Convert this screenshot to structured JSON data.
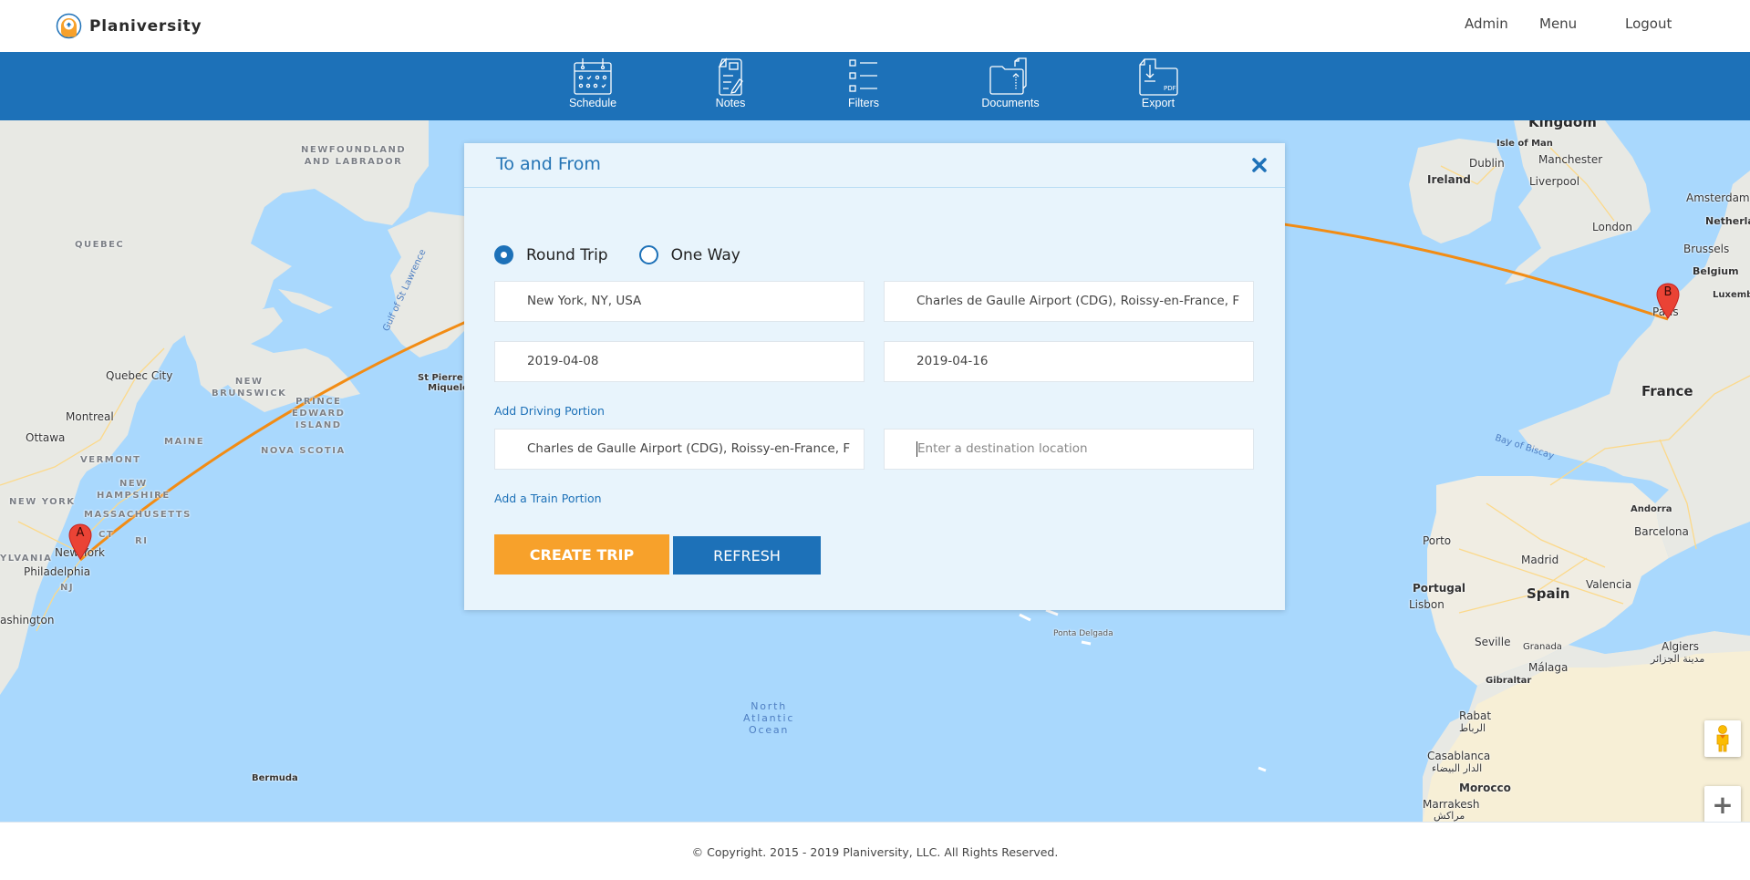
{
  "header": {
    "brand": "Planiversity",
    "nav": [
      {
        "label": "Admin"
      },
      {
        "label": "Menu"
      },
      {
        "label": "Logout"
      }
    ]
  },
  "toolbar": {
    "items": [
      {
        "label": "Schedule",
        "icon": "calendar-icon"
      },
      {
        "label": "Notes",
        "icon": "notes-icon"
      },
      {
        "label": "Filters",
        "icon": "filters-list-icon"
      },
      {
        "label": "Documents",
        "icon": "folder-upload-icon"
      },
      {
        "label": "Export",
        "icon": "pdf-export-icon"
      }
    ]
  },
  "dialog": {
    "title": "To and From",
    "close_icon": "close-icon",
    "trip_type": {
      "options": [
        {
          "label": "Round Trip",
          "checked": true
        },
        {
          "label": "One Way",
          "checked": false
        }
      ]
    },
    "origin": "New York, NY, USA",
    "destination": "Charles de Gaulle Airport (CDG), Roissy-en-France, F",
    "depart_date": "2019-04-08",
    "return_date": "2019-04-16",
    "add_driving_label": "Add Driving Portion",
    "driving_from": "Charles de Gaulle Airport (CDG), Roissy-en-France, F",
    "driving_to_value": "",
    "driving_to_placeholder": "Enter a destination location",
    "add_train_label": "Add a Train Portion",
    "create_label": "CREATE TRIP",
    "refresh_label": "REFRESH"
  },
  "map": {
    "route_color": "#f28c14",
    "markers": [
      {
        "label": "A",
        "place": "New York"
      },
      {
        "label": "B",
        "place": "Paris"
      }
    ],
    "labels": {
      "newfoundland": "NEWFOUNDLAND\nAND LABRADOR",
      "quebec": "QUEBEC",
      "gulf": "Gulf of St Lawrence",
      "quebec_city": "Quebec City",
      "new_brunswick": "NEW\nBRUNSWICK",
      "pei": "PRINCE\nEDWARD\nISLAND",
      "montreal": "Montreal",
      "ottawa": "Ottawa",
      "maine": "MAINE",
      "nova_scotia": "NOVA SCOTIA",
      "vermont": "VERMONT",
      "new_hampshire": "NEW\nHAMPSHIRE",
      "new_york_state": "NEW YORK",
      "massachusetts": "MASSACHUSETTS",
      "ct": "CT",
      "ri": "RI",
      "new_york": "New York",
      "pennsylvania": "YLVANIA",
      "philadelphia": "Philadelphia",
      "nj": "NJ",
      "washington": "ashington",
      "bermuda": "Bermuda",
      "st_pierre": "St Pierre and\nMiquelon",
      "ocean": "North\nAtlantic\nOcean",
      "ponta_delgada": "Ponta Delgada",
      "kingdom": "Kingdom",
      "isle_of_man": "Isle of Man",
      "dublin": "Dublin",
      "ireland": "Ireland",
      "manchester": "Manchester",
      "liverpool": "Liverpool",
      "london": "London",
      "amsterdam": "Amsterdam",
      "netherlands": "Netherlar",
      "brussels": "Brussels",
      "belgium": "Belgium",
      "luxembourg": "Luxemb",
      "paris": "Paris",
      "france": "France",
      "bay_of_biscay": "Bay of Biscay",
      "andorra": "Andorra",
      "barcelona": "Barcelona",
      "porto": "Porto",
      "madrid": "Madrid",
      "portugal": "Portugal",
      "spain": "Spain",
      "valencia": "Valencia",
      "lisbon": "Lisbon",
      "seville": "Seville",
      "granada": "Granada",
      "malaga": "Málaga",
      "gibraltar": "Gibraltar",
      "algiers": "Algiers",
      "algiers_ar": "مدينة الجزائر",
      "rabat": "Rabat",
      "rabat_ar": "الرباط",
      "casablanca": "Casablanca",
      "casablanca_ar": "الدار البيضاء",
      "morocco": "Morocco",
      "marrakesh": "Marrakesh",
      "marrakesh_ar": "مراكش"
    },
    "controls": {
      "street_view": "pegman-icon",
      "zoom_in": "+"
    }
  },
  "footer": {
    "copyright": "© Copyright. 2015 - 2019 Planiversity, LLC. All Rights Reserved."
  }
}
